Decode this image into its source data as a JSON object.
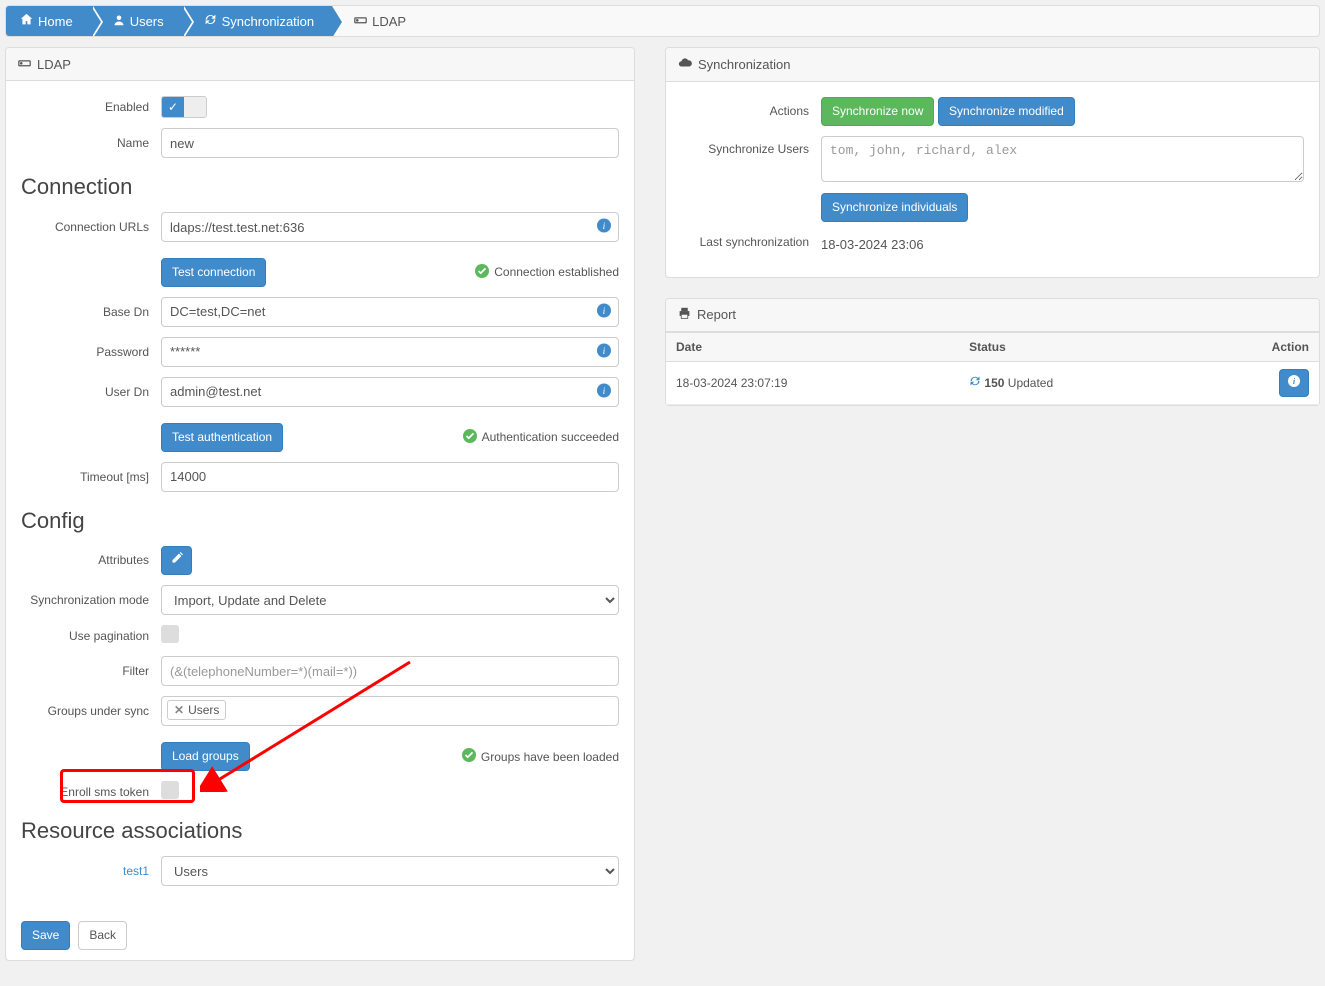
{
  "breadcrumb": {
    "home": "Home",
    "users": "Users",
    "sync": "Synchronization",
    "ldap": "LDAP"
  },
  "leftPanel": {
    "title": "LDAP",
    "labels": {
      "enabled": "Enabled",
      "name": "Name",
      "connection_urls": "Connection URLs",
      "base_dn": "Base Dn",
      "password": "Password",
      "user_dn": "User Dn",
      "timeout": "Timeout [ms]",
      "attributes": "Attributes",
      "sync_mode": "Synchronization mode",
      "use_pagination": "Use pagination",
      "filter": "Filter",
      "groups_under_sync": "Groups under sync",
      "enroll_sms": "Enroll sms token",
      "test1": "test1"
    },
    "sections": {
      "connection": "Connection",
      "config": "Config",
      "resource_assoc": "Resource associations"
    },
    "values": {
      "name": "new",
      "conn_urls": "ldaps://test.test.net:636",
      "base_dn": "DC=test,DC=net",
      "password": "******",
      "user_dn": "admin@test.net",
      "timeout": "14000",
      "filter_placeholder": "(&(telephoneNumber=*)(mail=*))",
      "sync_mode": "Import, Update and Delete",
      "group_tag": "Users",
      "resource_select": "Users"
    },
    "buttons": {
      "test_connection": "Test connection",
      "test_auth": "Test authentication",
      "load_groups": "Load groups",
      "save": "Save",
      "back": "Back"
    },
    "status": {
      "conn_ok": "Connection established",
      "auth_ok": "Authentication succeeded",
      "groups_ok": "Groups have been loaded"
    }
  },
  "syncPanel": {
    "title": "Synchronization",
    "labels": {
      "actions": "Actions",
      "sync_users": "Synchronize Users",
      "last_sync": "Last synchronization"
    },
    "buttons": {
      "sync_now": "Synchronize now",
      "sync_mod": "Synchronize modified",
      "sync_indiv": "Synchronize individuals"
    },
    "users_placeholder": "tom, john, richard, alex",
    "last_sync_value": "18-03-2024 23:06"
  },
  "reportPanel": {
    "title": "Report",
    "headers": {
      "date": "Date",
      "status": "Status",
      "action": "Action"
    },
    "row": {
      "date": "18-03-2024 23:07:19",
      "count": "150",
      "status": " Updated"
    }
  }
}
